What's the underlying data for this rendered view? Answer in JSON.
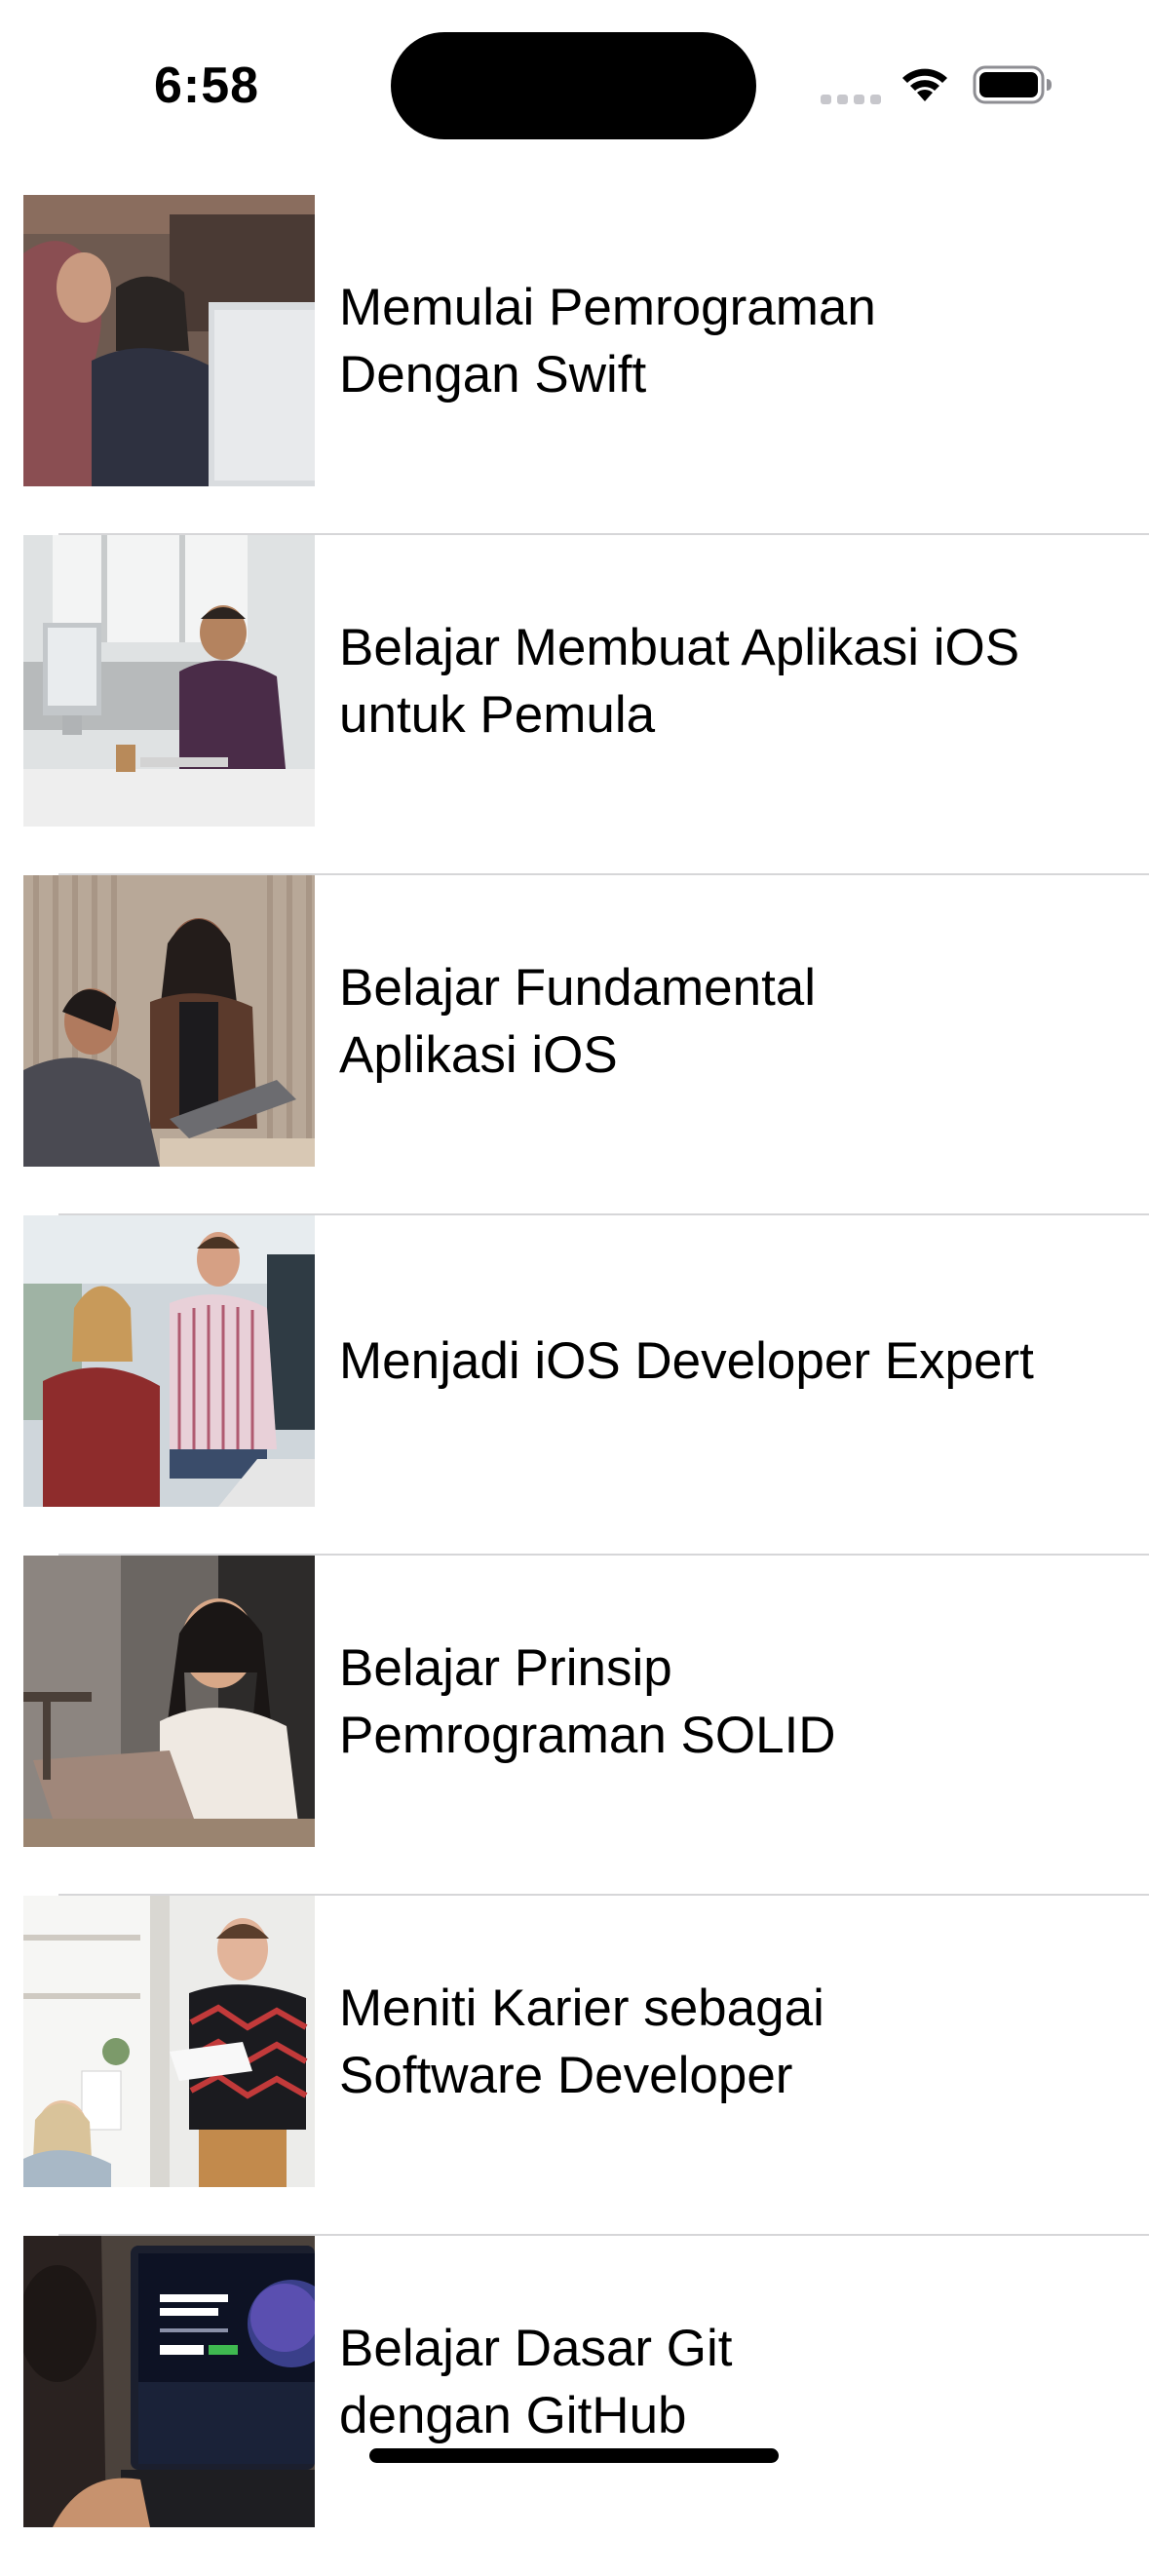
{
  "status_bar": {
    "time": "6:58",
    "icons": [
      "signal-dots-icon",
      "wifi-icon",
      "battery-icon"
    ]
  },
  "courses": [
    {
      "title": "Memulai Pemrograman\nDengan Swift",
      "image": "two-women-at-computer-photo"
    },
    {
      "title": "Belajar Membuat Aplikasi iOS\nuntuk Pemula",
      "image": "man-at-office-desk-photo"
    },
    {
      "title": "Belajar Fundamental\nAplikasi iOS",
      "image": "two-women-with-laptop-photo"
    },
    {
      "title": "Menjadi iOS Developer Expert",
      "image": "colleagues-discussing-photo"
    },
    {
      "title": "Belajar Prinsip\nPemrograman SOLID",
      "image": "woman-smiling-at-laptop-photo"
    },
    {
      "title": "Meniti Karier sebagai\nSoftware Developer",
      "image": "man-holding-paper-photo"
    },
    {
      "title": "Belajar Dasar Git\ndengan GitHub",
      "image": "laptop-github-page-photo"
    }
  ],
  "colors": {
    "background": "#ffffff",
    "text": "#000000",
    "separator": "#d6d6d8"
  }
}
